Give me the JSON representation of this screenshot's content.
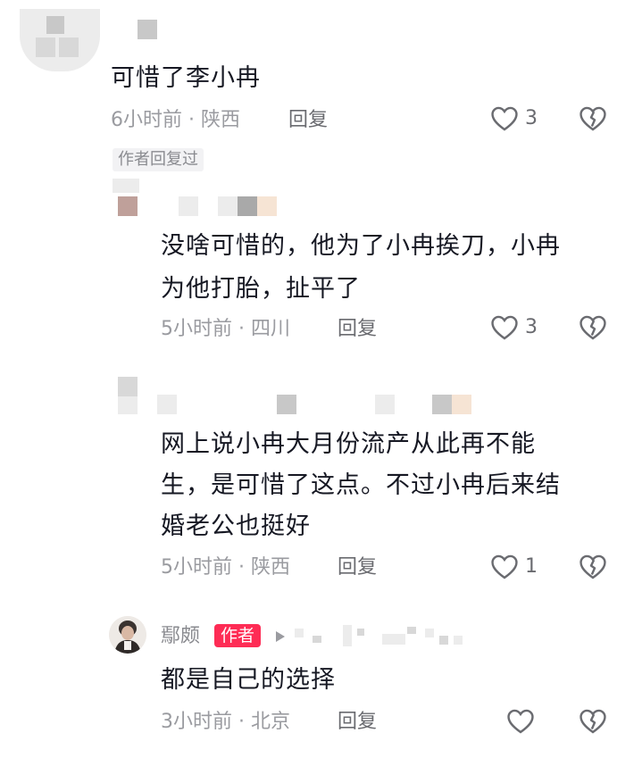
{
  "comments": [
    {
      "text": "可惜了李小冉",
      "time_location": "6小时前 · 陕西",
      "reply_label": "回复",
      "likes": "3",
      "tag": "作者回复过"
    },
    {
      "text_lines": [
        "没啥可惜的，他为了小冉挨刀，小冉",
        "为他打胎，扯平了"
      ],
      "time_location": "5小时前 · 四川",
      "reply_label": "回复",
      "likes": "3"
    },
    {
      "text_lines": [
        "网上说小冉大月份流产从此再不能",
        "生，是可惜了这点。不过小冉后来结",
        "婚老公也挺好"
      ],
      "time_location": "5小时前 · 陕西",
      "reply_label": "回复",
      "likes": "1"
    },
    {
      "author_name": "鄢颇",
      "author_badge": "作者",
      "text": "都是自己的选择",
      "time_location": "3小时前 · 北京",
      "reply_label": "回复",
      "likes": ""
    }
  ],
  "icons": {
    "like": "heart-outline-icon",
    "dislike": "broken-heart-icon",
    "reply_arrow": "triangle-right-icon"
  },
  "colors": {
    "author_badge_bg": "#fe2c55",
    "meta_text": "#9a9ba0"
  }
}
